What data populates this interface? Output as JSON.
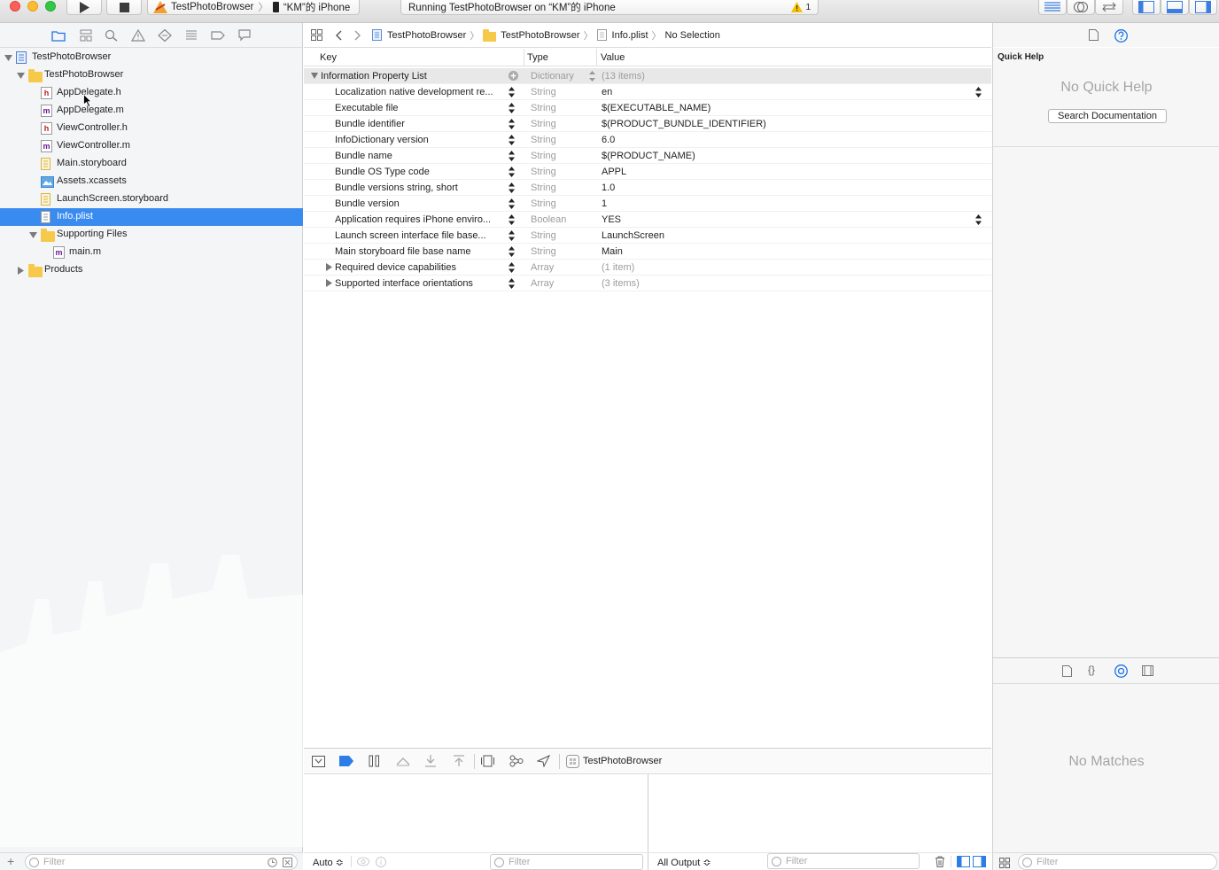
{
  "window": {
    "scheme_app": "TestPhotoBrowser",
    "scheme_device": "“KM”的 iPhone",
    "status": "Running TestPhotoBrowser on “KM”的 iPhone",
    "warning_count": "1"
  },
  "navigator": {
    "tree": [
      {
        "label": "TestPhotoBrowser",
        "kind": "project",
        "level": 0,
        "expanded": true
      },
      {
        "label": "TestPhotoBrowser",
        "kind": "folder",
        "level": 1,
        "expanded": true
      },
      {
        "label": "AppDelegate.h",
        "kind": "h",
        "level": 2
      },
      {
        "label": "AppDelegate.m",
        "kind": "m",
        "level": 2
      },
      {
        "label": "ViewController.h",
        "kind": "h",
        "level": 2
      },
      {
        "label": "ViewController.m",
        "kind": "m",
        "level": 2
      },
      {
        "label": "Main.storyboard",
        "kind": "storyboard",
        "level": 2
      },
      {
        "label": "Assets.xcassets",
        "kind": "assets",
        "level": 2
      },
      {
        "label": "LaunchScreen.storyboard",
        "kind": "storyboard",
        "level": 2
      },
      {
        "label": "Info.plist",
        "kind": "plist",
        "level": 2,
        "selected": true
      },
      {
        "label": "Supporting Files",
        "kind": "folder",
        "level": 2,
        "expanded": true
      },
      {
        "label": "main.m",
        "kind": "m",
        "level": 3
      },
      {
        "label": "Products",
        "kind": "folder",
        "level": 1,
        "expanded": false
      }
    ],
    "filter_placeholder": "Filter"
  },
  "jumpbar": {
    "crumbs": [
      "TestPhotoBrowser",
      "TestPhotoBrowser",
      "Info.plist",
      "No Selection"
    ]
  },
  "plist": {
    "headers": {
      "key": "Key",
      "type": "Type",
      "value": "Value"
    },
    "root": {
      "key": "Information Property List",
      "type": "Dictionary",
      "value": "(13 items)"
    },
    "rows": [
      {
        "key": "Localization native development re...",
        "type": "String",
        "value": "en",
        "popup": true
      },
      {
        "key": "Executable file",
        "type": "String",
        "value": "$(EXECUTABLE_NAME)"
      },
      {
        "key": "Bundle identifier",
        "type": "String",
        "value": "$(PRODUCT_BUNDLE_IDENTIFIER)"
      },
      {
        "key": "InfoDictionary version",
        "type": "String",
        "value": "6.0"
      },
      {
        "key": "Bundle name",
        "type": "String",
        "value": "$(PRODUCT_NAME)"
      },
      {
        "key": "Bundle OS Type code",
        "type": "String",
        "value": "APPL"
      },
      {
        "key": "Bundle versions string, short",
        "type": "String",
        "value": "1.0"
      },
      {
        "key": "Bundle version",
        "type": "String",
        "value": "1"
      },
      {
        "key": "Application requires iPhone enviro...",
        "type": "Boolean",
        "value": "YES",
        "popup": true
      },
      {
        "key": "Launch screen interface file base...",
        "type": "String",
        "value": "LaunchScreen"
      },
      {
        "key": "Main storyboard file base name",
        "type": "String",
        "value": "Main"
      },
      {
        "key": "Required device capabilities",
        "type": "Array",
        "value": "(1 item)",
        "collapsed": true
      },
      {
        "key": "Supported interface orientations",
        "type": "Array",
        "value": "(3 items)",
        "collapsed": true
      }
    ]
  },
  "debug": {
    "process": "TestPhotoBrowser",
    "auto_label": "Auto ≎",
    "filter_placeholder": "Filter",
    "output_label": "All Output ≎"
  },
  "inspector": {
    "title": "Quick Help",
    "empty": "No Quick Help",
    "search_button": "Search Documentation",
    "library_empty": "No Matches",
    "filter_placeholder": "Filter"
  },
  "colors": {
    "selection": "#3a8bf0",
    "accent": "#1a73e8",
    "folder": "#f7c94b"
  }
}
